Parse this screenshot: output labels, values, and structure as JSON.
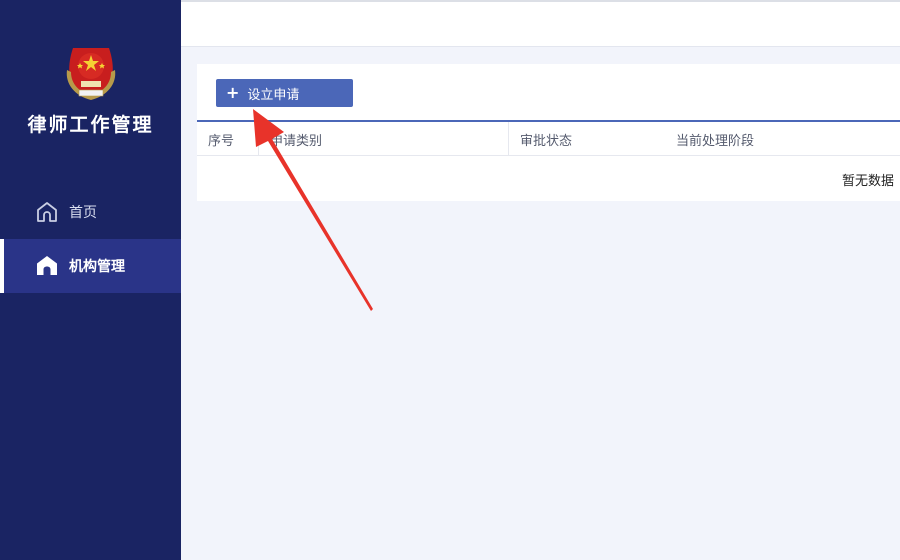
{
  "app": {
    "title": "律师工作管理"
  },
  "sidebar": {
    "items": [
      {
        "label": "首页",
        "icon": "home-outline-icon",
        "active": false
      },
      {
        "label": "机构管理",
        "icon": "home-filled-icon",
        "active": true
      }
    ]
  },
  "toolbar": {
    "create_label": "设立申请"
  },
  "table": {
    "columns": [
      "序号",
      "申请类别",
      "审批状态",
      "当前处理阶段"
    ],
    "empty_text": "暂无数据"
  },
  "colors": {
    "sidebar_bg": "#1a2463",
    "active_item_bg": "#2a3488",
    "primary": "#4b67b8",
    "annotation_arrow": "#e8332a"
  }
}
